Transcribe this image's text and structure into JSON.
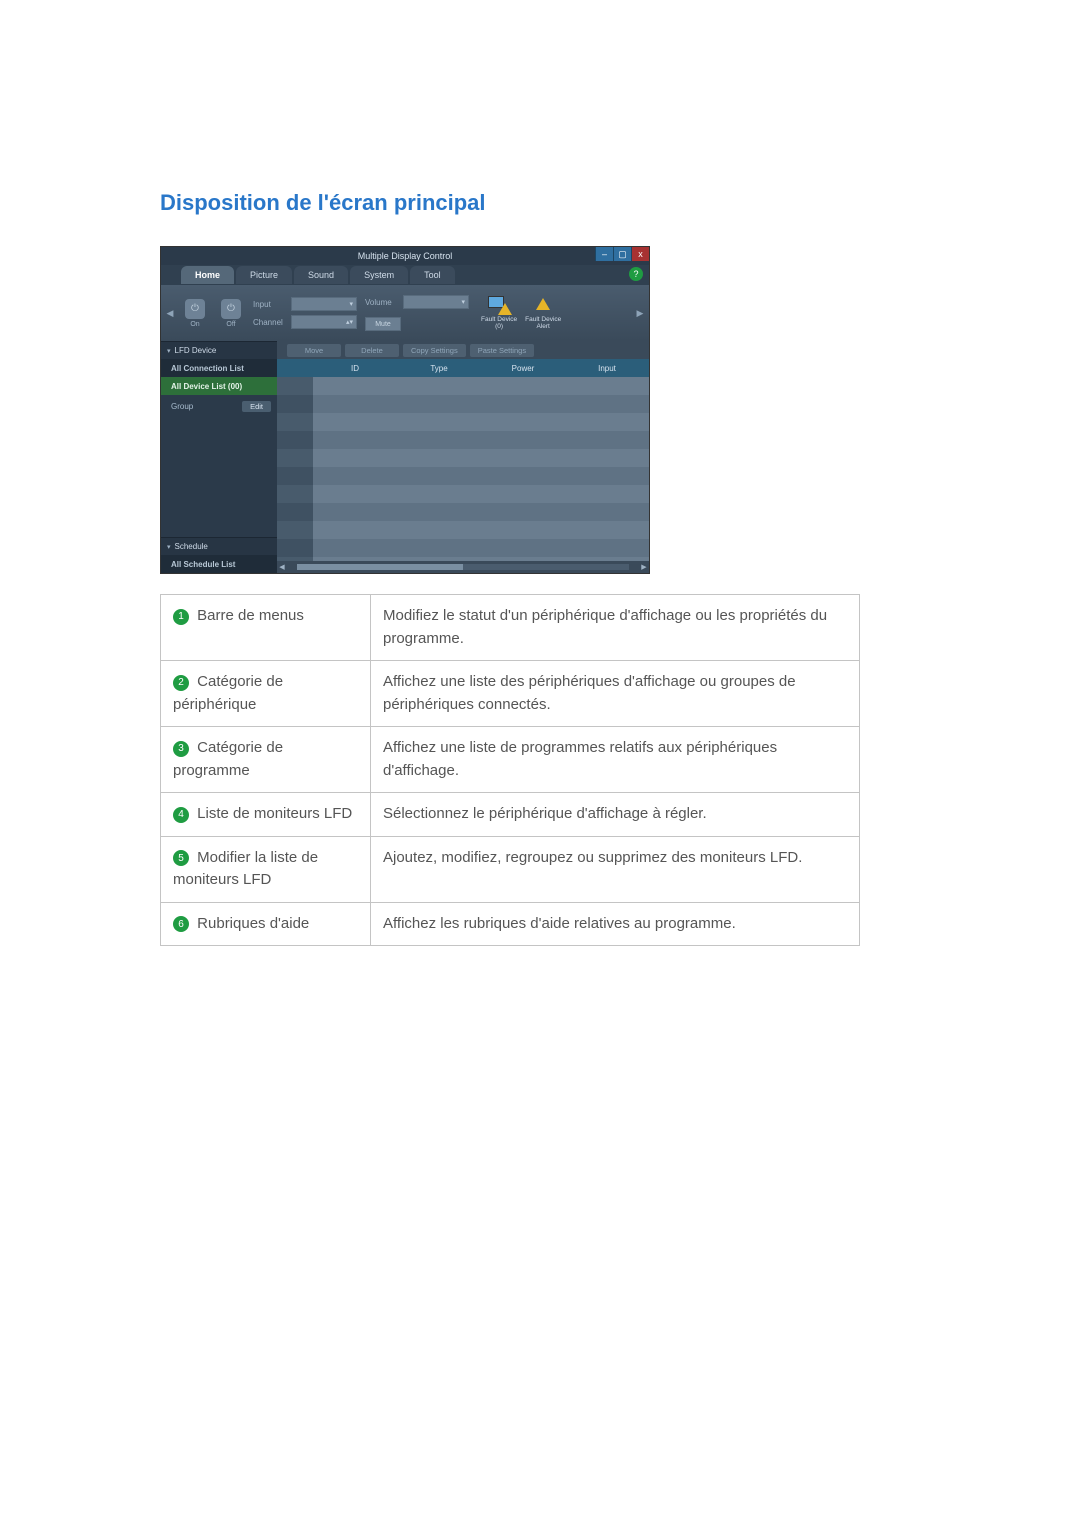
{
  "section_title": "Disposition de l'écran principal",
  "window": {
    "title": "Multiple Display Control",
    "controls": {
      "min": "–",
      "max": "▢",
      "close": "x"
    }
  },
  "tabs": {
    "home": "Home",
    "picture": "Picture",
    "sound": "Sound",
    "system": "System",
    "tool": "Tool"
  },
  "help_icon": "?",
  "toolbar": {
    "power_on": "On",
    "power_off": "Off",
    "power_symbol": "⏻",
    "input_label": "Input",
    "channel_label": "Channel",
    "volume_label": "Volume",
    "mute_label": "Mute",
    "fault_device": "Fault Device\n(0)",
    "fault_alert": "Fault Device\nAlert"
  },
  "sidebar": {
    "lfd_header": "LFD Device",
    "all_connection": "All Connection List",
    "all_device": "All Device List (00)",
    "group_label": "Group",
    "edit_label": "Edit",
    "schedule_header": "Schedule",
    "all_schedule": "All Schedule List"
  },
  "actions": {
    "move": "Move",
    "delete": "Delete",
    "copy": "Copy Settings",
    "paste": "Paste Settings"
  },
  "columns": {
    "id": "ID",
    "type": "Type",
    "power": "Power",
    "input": "Input"
  },
  "legend": {
    "r1_term": "Barre de menus",
    "r1_desc": "Modifiez le statut d'un périphérique d'affichage ou les propriétés du programme.",
    "r2_term": "Catégorie de périphérique",
    "r2_desc": "Affichez une liste des périphériques d'affichage ou groupes de périphériques connectés.",
    "r3_term": "Catégorie de programme",
    "r3_desc": "Affichez une liste de programmes relatifs aux périphériques d'affichage.",
    "r4_term": "Liste de moniteurs LFD",
    "r4_desc": "Sélectionnez le périphérique d'affichage à régler.",
    "r5_term": "Modifier la liste de moniteurs LFD",
    "r5_desc": "Ajoutez, modifiez, regroupez ou supprimez des moniteurs LFD.",
    "r6_term": "Rubriques d'aide",
    "r6_desc": "Affichez les rubriques d'aide relatives au programme."
  }
}
